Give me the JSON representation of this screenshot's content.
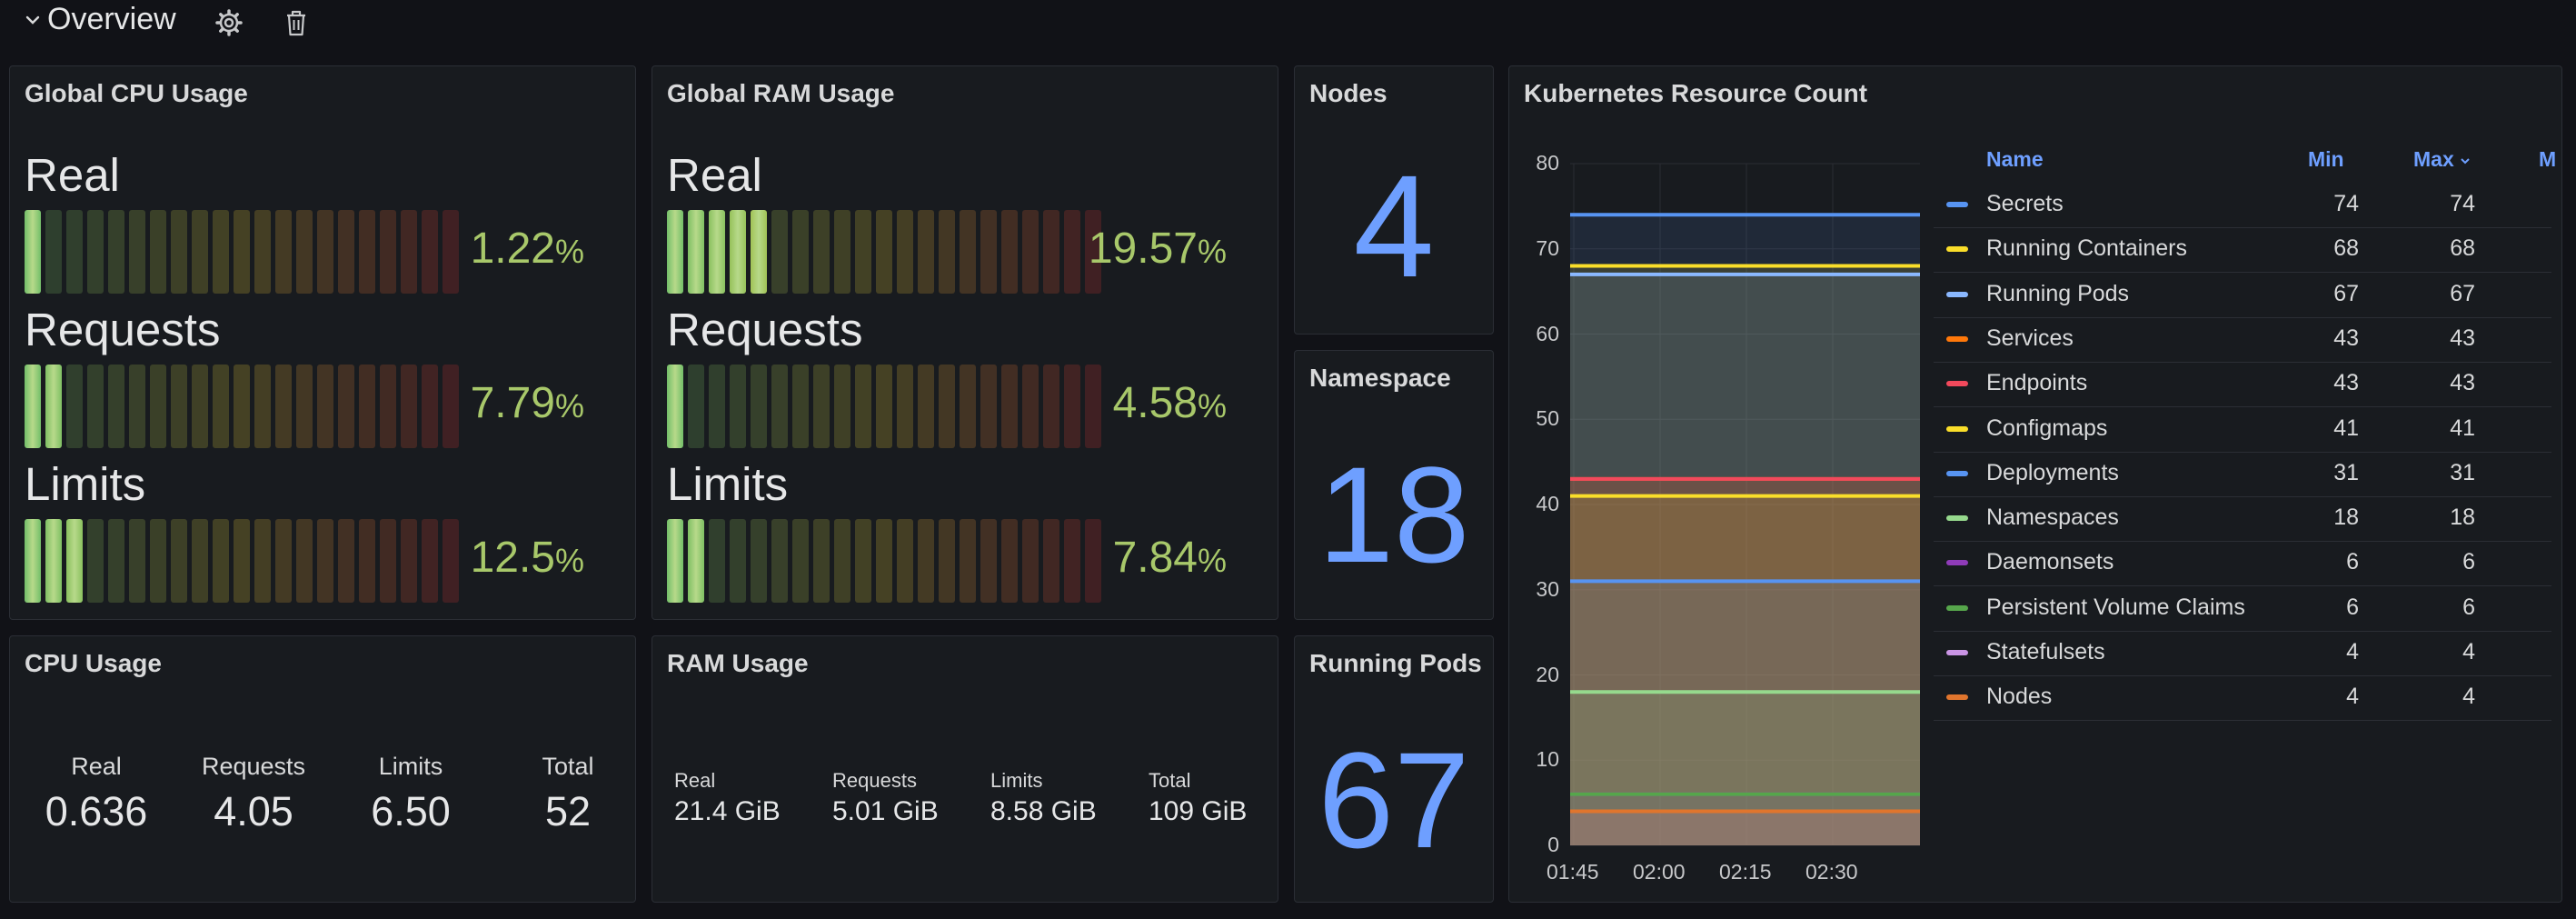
{
  "row": {
    "title": "Overview"
  },
  "cpu_panel": {
    "title": "Global CPU Usage",
    "gauges": [
      {
        "label": "Real",
        "value": "1.22",
        "unit": "%",
        "fraction": 0.0122
      },
      {
        "label": "Requests",
        "value": "7.79",
        "unit": "%",
        "fraction": 0.0779
      },
      {
        "label": "Limits",
        "value": "12.5",
        "unit": "%",
        "fraction": 0.125
      }
    ]
  },
  "ram_panel": {
    "title": "Global RAM Usage",
    "gauges": [
      {
        "label": "Real",
        "value": "19.57",
        "unit": "%",
        "fraction": 0.1957
      },
      {
        "label": "Requests",
        "value": "4.58",
        "unit": "%",
        "fraction": 0.0458
      },
      {
        "label": "Limits",
        "value": "7.84",
        "unit": "%",
        "fraction": 0.0784
      }
    ]
  },
  "nodes_panel": {
    "title": "Nodes",
    "value": "4"
  },
  "namespace_panel": {
    "title": "Namespace",
    "value": "18"
  },
  "pods_panel": {
    "title": "Running Pods",
    "value": "67"
  },
  "cpu_usage_panel": {
    "title": "CPU Usage",
    "items": [
      {
        "label": "Real",
        "value": "0.636"
      },
      {
        "label": "Requests",
        "value": "4.05"
      },
      {
        "label": "Limits",
        "value": "6.50"
      },
      {
        "label": "Total",
        "value": "52"
      }
    ]
  },
  "ram_usage_panel": {
    "title": "RAM Usage",
    "items": [
      {
        "label": "Real",
        "value": "21.4 GiB"
      },
      {
        "label": "Requests",
        "value": "5.01 GiB"
      },
      {
        "label": "Limits",
        "value": "8.58 GiB"
      },
      {
        "label": "Total",
        "value": "109 GiB"
      }
    ]
  },
  "k8s_panel": {
    "title": "Kubernetes Resource Count",
    "legend_headers": {
      "name": "Name",
      "min": "Min",
      "max": "Max",
      "mean": "M"
    }
  },
  "colors": {
    "accent": "#6e9fff",
    "gauge_green": "#73bf69",
    "gauge_value": "#a8c86a"
  },
  "chart_data": {
    "type": "area",
    "title": "Kubernetes Resource Count",
    "x": [
      "01:45",
      "02:00",
      "02:15",
      "02:30"
    ],
    "ylim": [
      0,
      80
    ],
    "yticks": [
      0,
      10,
      20,
      30,
      40,
      50,
      60,
      70,
      80
    ],
    "grid": true,
    "legend_placement": "right",
    "series": [
      {
        "name": "Secrets",
        "color": "#5794f2",
        "min": 74,
        "max": 74,
        "values": [
          74,
          74,
          74,
          74
        ]
      },
      {
        "name": "Running Containers",
        "color": "#fade2a",
        "min": 68,
        "max": 68,
        "values": [
          68,
          68,
          68,
          68
        ]
      },
      {
        "name": "Running Pods",
        "color": "#8ab8ff",
        "min": 67,
        "max": 67,
        "values": [
          67,
          67,
          67,
          67
        ]
      },
      {
        "name": "Services",
        "color": "#ff780a",
        "min": 43,
        "max": 43,
        "values": [
          43,
          43,
          43,
          43
        ]
      },
      {
        "name": "Endpoints",
        "color": "#f2495c",
        "min": 43,
        "max": 43,
        "values": [
          43,
          43,
          43,
          43
        ]
      },
      {
        "name": "Configmaps",
        "color": "#fade2a",
        "min": 41,
        "max": 41,
        "values": [
          41,
          41,
          41,
          41
        ]
      },
      {
        "name": "Deployments",
        "color": "#5794f2",
        "min": 31,
        "max": 31,
        "values": [
          31,
          31,
          31,
          31
        ]
      },
      {
        "name": "Namespaces",
        "color": "#96d98d",
        "min": 18,
        "max": 18,
        "values": [
          18,
          18,
          18,
          18
        ]
      },
      {
        "name": "Daemonsets",
        "color": "#8f3bb8",
        "min": 6,
        "max": 6,
        "values": [
          6,
          6,
          6,
          6
        ]
      },
      {
        "name": "Persistent Volume Claims",
        "color": "#56a64b",
        "min": 6,
        "max": 6,
        "values": [
          6,
          6,
          6,
          6
        ]
      },
      {
        "name": "Statefulsets",
        "color": "#ca95e5",
        "min": 4,
        "max": 4,
        "values": [
          4,
          4,
          4,
          4
        ]
      },
      {
        "name": "Nodes",
        "color": "#e0752d",
        "min": 4,
        "max": 4,
        "values": [
          4,
          4,
          4,
          4
        ]
      }
    ]
  }
}
